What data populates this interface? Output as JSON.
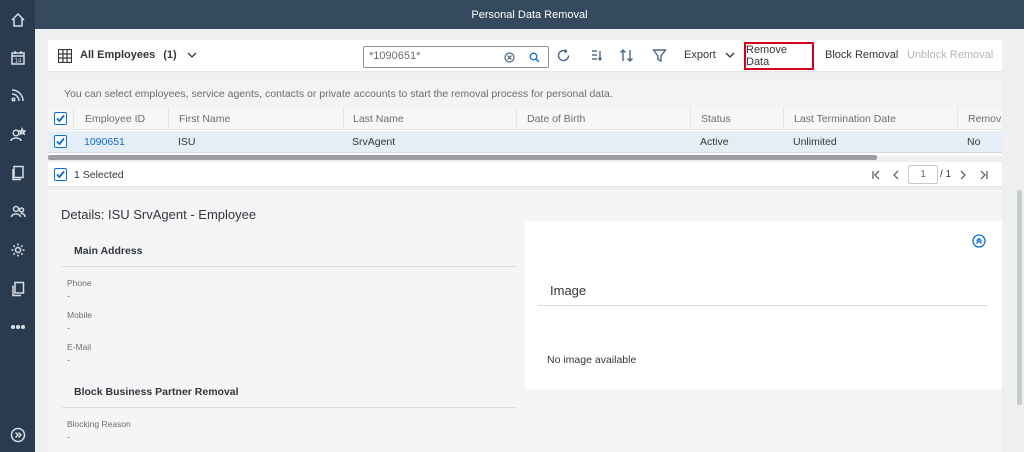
{
  "app": {
    "title": "Personal Data Removal"
  },
  "sidebar": {
    "icons": [
      "home-icon",
      "calendar-icon",
      "feed-icon",
      "people-star-icon",
      "documents-icon",
      "employees-icon",
      "settings-people-icon",
      "copy-icon",
      "more-icon",
      "expand-icon"
    ],
    "calendar_day": "14"
  },
  "toolbar": {
    "variant_label": "All Employees",
    "variant_count": "(1)",
    "search_placeholder": "*1090651*",
    "export_label": "Export",
    "remove_data_label": "Remove Data",
    "block_removal_label": "Block Removal",
    "unblock_removal_label": "Unblock Removal"
  },
  "info": {
    "text": "You can select employees, service agents, contacts or private accounts to start the removal process for personal data."
  },
  "table": {
    "columns": [
      "Employee ID",
      "First Name",
      "Last Name",
      "Date of Birth",
      "Status",
      "Last Termination Date",
      "Remova"
    ],
    "rows": [
      {
        "employee_id": "1090651",
        "first_name": "ISU",
        "last_name": "SrvAgent",
        "date_of_birth": "",
        "status": "Active",
        "last_termination_date": "Unlimited",
        "removal": "No"
      }
    ]
  },
  "footer": {
    "selected_text": "1 Selected",
    "page_value": "1",
    "page_total": "/ 1"
  },
  "details": {
    "title": "Details: ISU SrvAgent - Employee",
    "main_address": {
      "title": "Main Address",
      "fields": [
        {
          "label": "Phone",
          "value": "-"
        },
        {
          "label": "Mobile",
          "value": "-"
        },
        {
          "label": "E-Mail",
          "value": "-"
        }
      ]
    },
    "block_section": {
      "title": "Block Business Partner Removal",
      "fields": [
        {
          "label": "Blocking Reason",
          "value": "-"
        }
      ]
    },
    "image": {
      "title": "Image",
      "empty_text": "No image available"
    }
  },
  "colors": {
    "shell": "#354a5f",
    "sidebar": "#2a3b4f",
    "accent": "#0a6ed1",
    "highlight_border": "#d0021b"
  }
}
